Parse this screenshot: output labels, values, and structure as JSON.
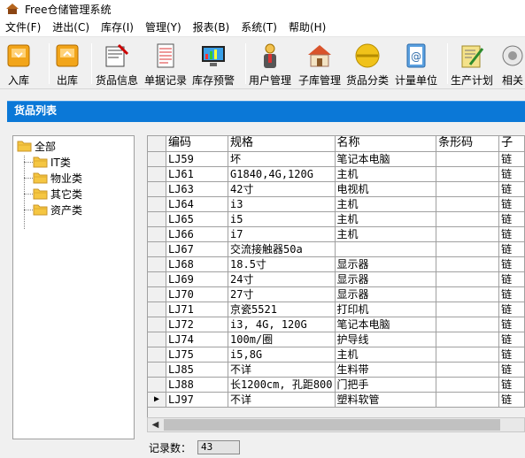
{
  "window": {
    "title": "Free仓储管理系统"
  },
  "menu": [
    "文件(F)",
    "进出(C)",
    "库存(I)",
    "管理(Y)",
    "报表(B)",
    "系统(T)",
    "帮助(H)"
  ],
  "toolbar": [
    {
      "label": "入库",
      "icon": "inbound-icon"
    },
    {
      "label": "出库",
      "icon": "outbound-icon"
    },
    {
      "label": "货品信息",
      "icon": "goods-info-icon"
    },
    {
      "label": "单据记录",
      "icon": "document-records-icon"
    },
    {
      "label": "库存预警",
      "icon": "stock-alert-monitor-icon"
    },
    {
      "label": "用户管理",
      "icon": "user-management-icon"
    },
    {
      "label": "子库管理",
      "icon": "sub-warehouse-icon"
    },
    {
      "label": "货品分类",
      "icon": "goods-category-icon"
    },
    {
      "label": "计量单位",
      "icon": "unit-icon"
    },
    {
      "label": "生产计划",
      "icon": "production-plan-icon"
    },
    {
      "label": "相关",
      "icon": "related-icon"
    }
  ],
  "section": {
    "title": "货品列表"
  },
  "tree": {
    "root": "全部",
    "children": [
      "IT类",
      "物业类",
      "其它类",
      "资产类"
    ]
  },
  "grid": {
    "columns": [
      "编码",
      "规格",
      "名称",
      "条形码",
      "子"
    ],
    "rows": [
      [
        "LJ59",
        "坏",
        "笔记本电脑",
        "",
        "链"
      ],
      [
        "LJ61",
        "G1840,4G,120G",
        "主机",
        "",
        "链"
      ],
      [
        "LJ63",
        "42寸",
        "电视机",
        "",
        "链"
      ],
      [
        "LJ64",
        "i3",
        "主机",
        "",
        "链"
      ],
      [
        "LJ65",
        "i5",
        "主机",
        "",
        "链"
      ],
      [
        "LJ66",
        "i7",
        "主机",
        "",
        "链"
      ],
      [
        "LJ67",
        "交流接触器50a",
        "",
        "",
        "链"
      ],
      [
        "LJ68",
        "18.5寸",
        "显示器",
        "",
        "链"
      ],
      [
        "LJ69",
        "24寸",
        "显示器",
        "",
        "链"
      ],
      [
        "LJ70",
        "27寸",
        "显示器",
        "",
        "链"
      ],
      [
        "LJ71",
        "京瓷5521",
        "打印机",
        "",
        "链"
      ],
      [
        "LJ72",
        "i3, 4G, 120G",
        "笔记本电脑",
        "",
        "链"
      ],
      [
        "LJ74",
        "100m/圈",
        "护导线",
        "",
        "链"
      ],
      [
        "LJ75",
        "i5,8G",
        "主机",
        "",
        "链"
      ],
      [
        "LJ85",
        "不详",
        "生料带",
        "",
        "链"
      ],
      [
        "LJ88",
        "长1200cm, 孔距800",
        "门把手",
        "",
        "链"
      ],
      [
        "LJ97",
        "不详",
        "塑料软管",
        "",
        "链"
      ]
    ],
    "current_row_index": 16,
    "current_marker": "▶"
  },
  "footer": {
    "record_label": "记录数：",
    "record_count": "43"
  }
}
